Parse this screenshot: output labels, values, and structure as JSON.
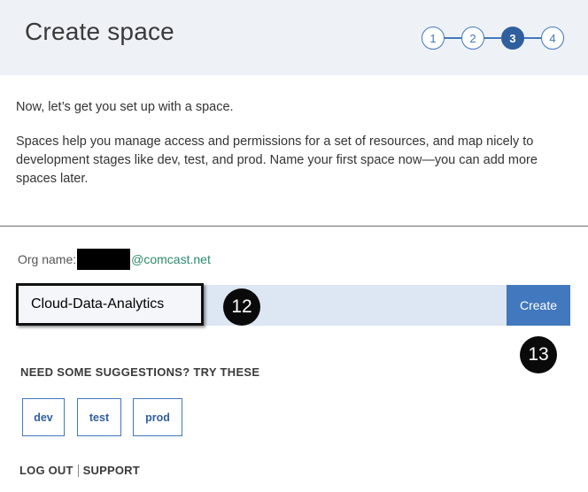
{
  "header": {
    "title": "Create space"
  },
  "stepper": {
    "steps": [
      "1",
      "2",
      "3",
      "4"
    ],
    "active": 3
  },
  "intro": {
    "line1": "Now, let’s get you set up with a space.",
    "line2": "Spaces help you manage access and permissions for a set of resources, and map nicely to development stages like dev, test, and prod. Name your first space now—you can add more spaces later."
  },
  "org": {
    "label": "Org name:",
    "domain": "@comcast.net"
  },
  "space": {
    "value": "Cloud-Data-Analytics",
    "create_label": "Create"
  },
  "markers": {
    "input_marker": "12",
    "create_marker": "13"
  },
  "suggestions": {
    "heading": "NEED SOME SUGGESTIONS? TRY THESE",
    "items": [
      "dev",
      "test",
      "prod"
    ]
  },
  "footer": {
    "logout": "LOG OUT",
    "support": "SUPPORT"
  },
  "colors": {
    "accent": "#4178be",
    "header_bg": "#eef1f6",
    "domain": "#2d8a6b"
  }
}
